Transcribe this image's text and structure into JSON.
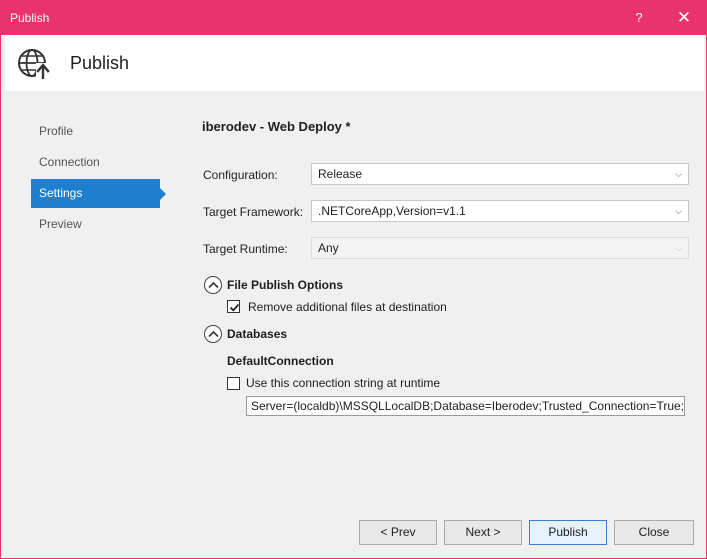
{
  "window": {
    "title": "Publish",
    "help_label": "?",
    "close_label": "✕"
  },
  "header": {
    "title": "Publish",
    "icon": "globe-publish-icon"
  },
  "nav": {
    "items": [
      {
        "label": "Profile"
      },
      {
        "label": "Connection"
      },
      {
        "label": "Settings",
        "active": true
      },
      {
        "label": "Preview"
      }
    ]
  },
  "main": {
    "profile_title": "iberodev - Web Deploy *",
    "configuration": {
      "label": "Configuration:",
      "value": "Release"
    },
    "target_framework": {
      "label": "Target Framework:",
      "value": ".NETCoreApp,Version=v1.1"
    },
    "target_runtime": {
      "label": "Target Runtime:",
      "value": "Any"
    },
    "file_publish_options": {
      "title": "File Publish Options",
      "remove_files_label": "Remove additional files at destination",
      "remove_files_checked": true
    },
    "databases": {
      "title": "Databases",
      "connection_name": "DefaultConnection",
      "use_at_runtime_label": "Use this connection string at runtime",
      "use_at_runtime_checked": false,
      "connection_string": "Server=(localdb)\\MSSQLLocalDB;Database=Iberodev;Trusted_Connection=True;M"
    }
  },
  "footer": {
    "prev_label": "< Prev",
    "next_label": "Next >",
    "publish_label": "Publish",
    "close_label": "Close"
  },
  "colors": {
    "titlebar": "#e8336d",
    "accent": "#1e7fcf"
  }
}
